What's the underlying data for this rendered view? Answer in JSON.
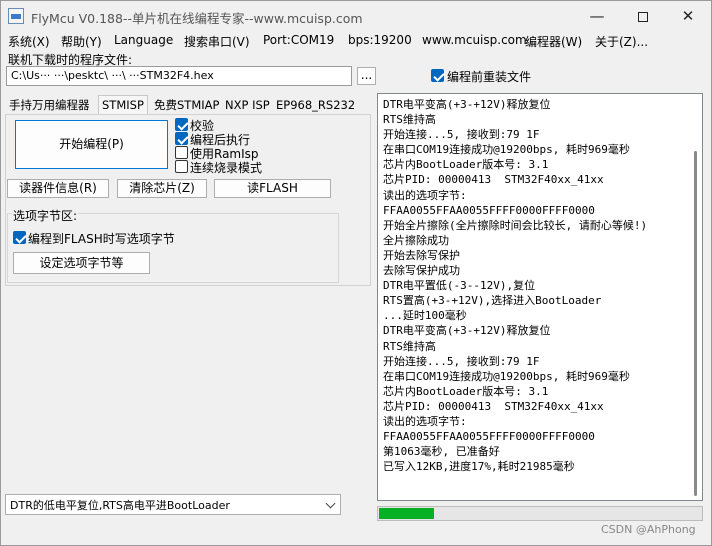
{
  "window": {
    "title": "FlyMcu V0.188--单片机在线编程专家--www.mcuisp.com",
    "min_glyph": "—",
    "close_glyph": "✕"
  },
  "menu": [
    "系统(X)",
    "帮助(Y)",
    "Language",
    "搜索串口(V)",
    "Port:COM19",
    "bps:19200",
    "www.mcuisp.com",
    "编程器(W)",
    "关于(Z)..."
  ],
  "file": {
    "label": "联机下载时的程序文件:",
    "path": "C:\\Us··· ···\\pesktc\\ ···\\ ···STM32F4.hex",
    "browse_label": "...",
    "reload_label": "编程前重装文件",
    "reload_checked": true
  },
  "tabs": [
    "手持万用编程器",
    "STMISP",
    "免费STMIAP",
    "NXP ISP",
    "EP968_RS232"
  ],
  "active_tab": 1,
  "stmisp": {
    "start_button": "开始编程(P)",
    "options": [
      {
        "label": "校验",
        "checked": true
      },
      {
        "label": "编程后执行",
        "checked": true
      },
      {
        "label": "使用RamIsp",
        "checked": false
      },
      {
        "label": "连续烧录模式",
        "checked": false
      }
    ],
    "read_info_button": "读器件信息(R)",
    "erase_button": "清除芯片(Z)",
    "read_flash_button": "读FLASH",
    "option_group_label": "选项字节区:",
    "write_option_label": "编程到FLASH时写选项字节",
    "write_option_checked": true,
    "set_option_button": "设定选项字节等"
  },
  "reset_mode": "DTR的低电平复位,RTS高电平进BootLoader",
  "log": [
    "DTR电平变高(+3-+12V)释放复位",
    "RTS维持高",
    "开始连接...5, 接收到:79 1F",
    "在串口COM19连接成功@19200bps, 耗时969毫秒",
    "芯片内BootLoader版本号: 3.1",
    "芯片PID: 00000413  STM32F40xx_41xx",
    "读出的选项字节:",
    "FFAA0055FFAA0055FFFF0000FFFF0000",
    "开始全片擦除(全片擦除时间会比较长, 请耐心等候!)",
    "全片擦除成功",
    "开始去除写保护",
    "去除写保护成功",
    "DTR电平置低(-3--12V),复位",
    "RTS置高(+3-+12V),选择进入BootLoader",
    "...延时100毫秒",
    "DTR电平变高(+3-+12V)释放复位",
    "RTS维持高",
    "开始连接...5, 接收到:79 1F",
    "在串口COM19连接成功@19200bps, 耗时969毫秒",
    "芯片内BootLoader版本号: 3.1",
    "芯片PID: 00000413  STM32F40xx_41xx",
    "读出的选项字节:",
    "FFAA0055FFAA0055FFFF0000FFFF0000",
    "第1063毫秒, 已准备好",
    "已写入12KB,进度17%,耗时21985毫秒"
  ],
  "progress_percent": 17,
  "colors": {
    "progress": "#06b025",
    "accent": "#0067c0"
  },
  "watermark": "CSDN @AhPhong"
}
